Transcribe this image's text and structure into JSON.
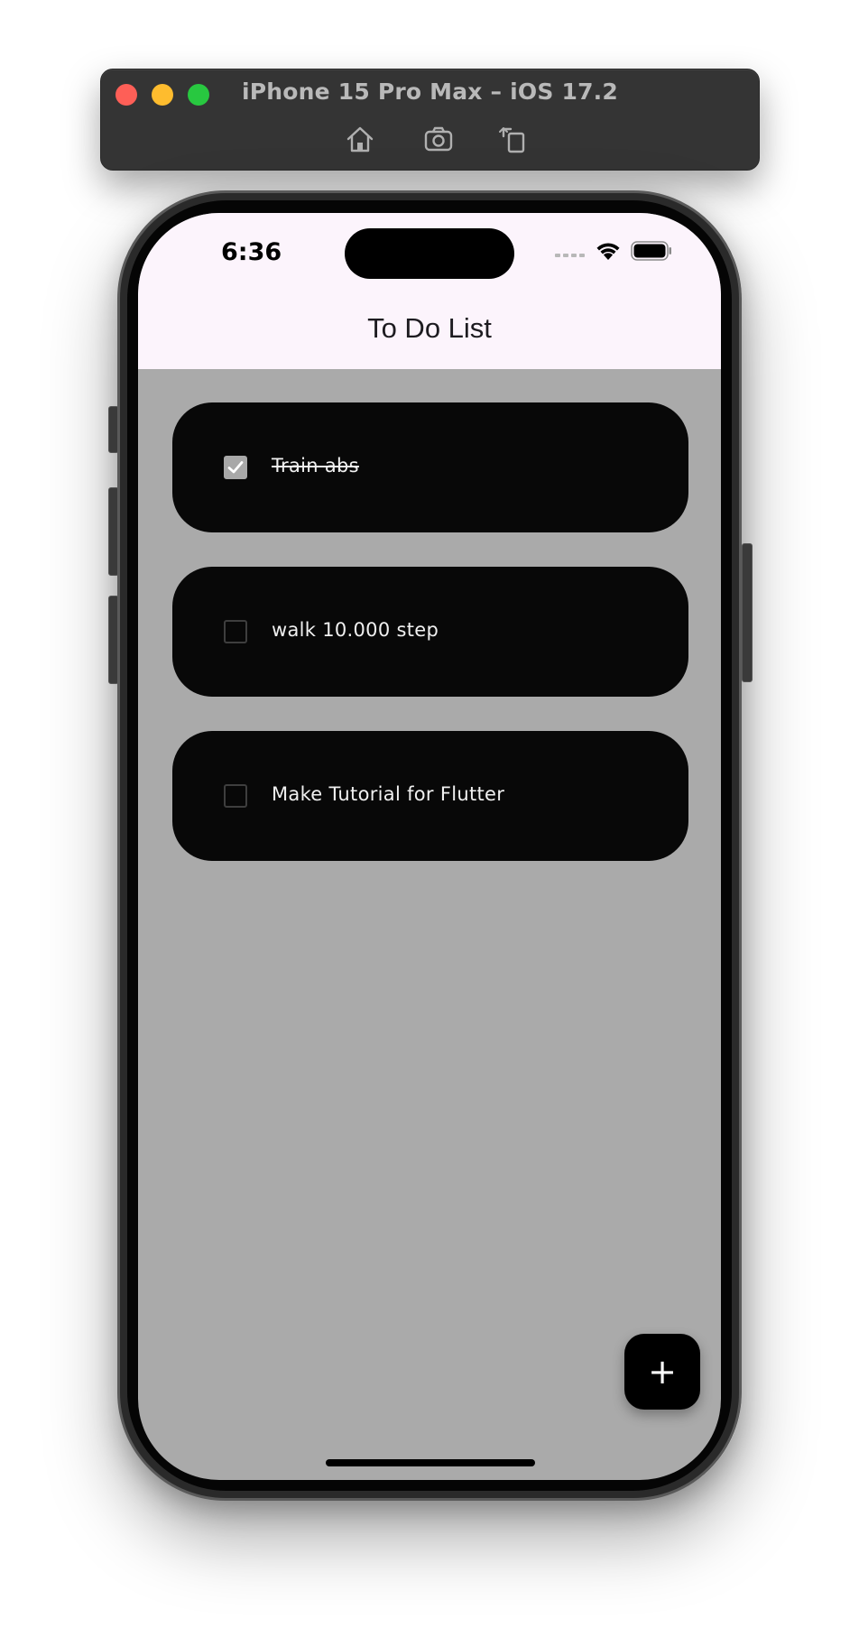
{
  "simulator": {
    "title": "iPhone 15 Pro Max – iOS 17.2",
    "toolbar_icons": [
      "home-icon",
      "screenshot-icon",
      "rotate-icon"
    ]
  },
  "status_bar": {
    "time": "6:36",
    "icons": [
      "cellular-icon",
      "wifi-icon",
      "battery-icon"
    ]
  },
  "app": {
    "title": "To Do List",
    "appbar_color": "#fcf4fc",
    "background_color": "#aaaaaa",
    "card_color": "#080808"
  },
  "tasks": [
    {
      "label": "Train abs",
      "completed": true
    },
    {
      "label": "walk 10.000 step",
      "completed": false
    },
    {
      "label": "Make Tutorial for Flutter",
      "completed": false
    }
  ],
  "fab": {
    "label": "+"
  }
}
